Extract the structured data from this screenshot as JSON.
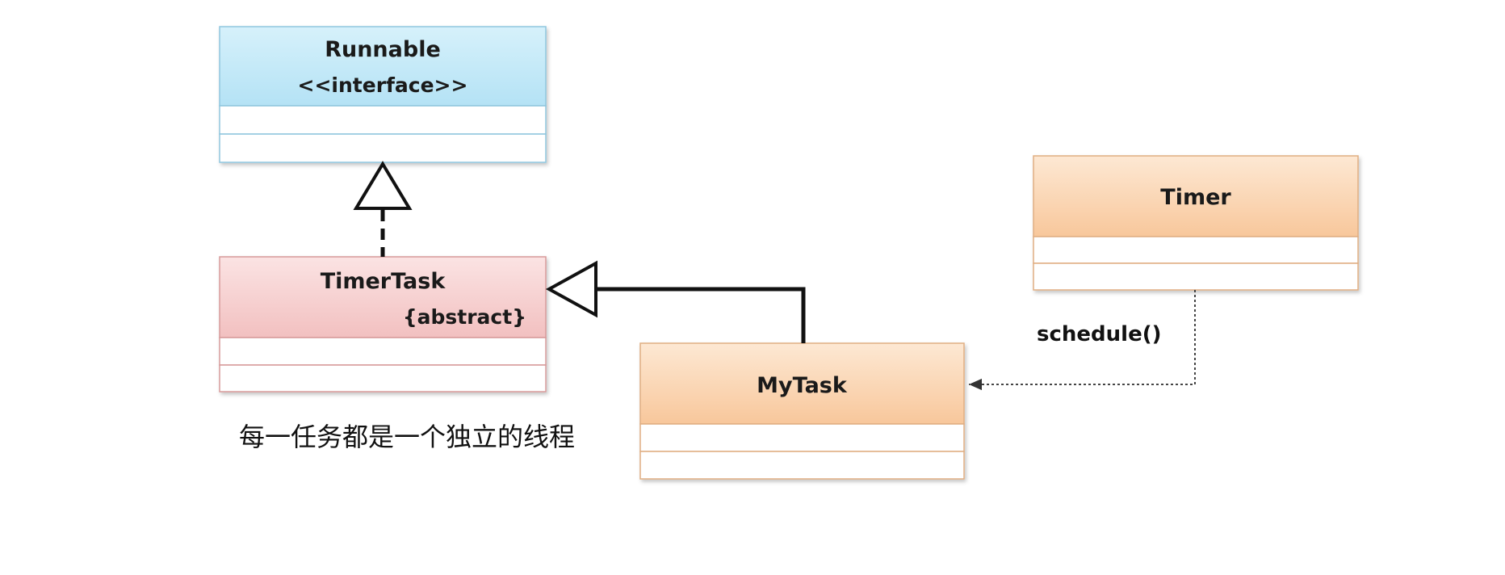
{
  "classes": {
    "runnable": {
      "name": "Runnable",
      "stereotype": "<<interface>>",
      "fill_top": "#d6f1fb",
      "fill_bottom": "#b4e2f5",
      "border": "#8fc6de"
    },
    "timer_task": {
      "name": "TimerTask",
      "modifier": "{abstract}",
      "fill_top": "#fbe3e3",
      "fill_bottom": "#f2c0c0",
      "border": "#d79a9a"
    },
    "my_task": {
      "name": "MyTask",
      "fill_top": "#fde8d3",
      "fill_bottom": "#f8c79b",
      "border": "#e0ae82"
    },
    "timer": {
      "name": "Timer",
      "fill_top": "#fde8d3",
      "fill_bottom": "#f8c79b",
      "border": "#e0ae82"
    }
  },
  "relations": {
    "realization": {
      "from": "TimerTask",
      "to": "Runnable"
    },
    "inheritance": {
      "from": "MyTask",
      "to": "TimerTask"
    },
    "dependency": {
      "from": "Timer",
      "to": "MyTask",
      "label": "schedule()"
    }
  },
  "note": "每一任务都是一个独立的线程"
}
